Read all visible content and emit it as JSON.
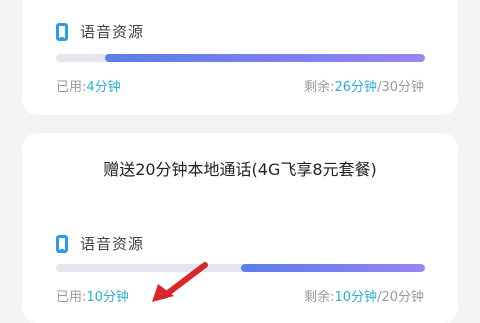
{
  "section1": {
    "resource_label": "语音资源",
    "used_prefix": "已用:",
    "used_value": "4分钟",
    "remaining_prefix": "剩余:",
    "remaining_value": "26分钟",
    "total_suffix": "/30分钟",
    "remaining_fraction": 0.8667
  },
  "section2": {
    "title": "赠送20分钟本地通话(4G飞享8元套餐)",
    "resource_label": "语音资源",
    "used_prefix": "已用:",
    "used_value": "10分钟",
    "remaining_prefix": "剩余:",
    "remaining_value": "10分钟",
    "total_suffix": "/20分钟",
    "remaining_fraction": 0.5
  },
  "colors": {
    "accent_blue": "#2f9be8",
    "highlight_teal": "#2bb0d6",
    "bar_fill": "#7a7ff0",
    "arrow_red": "#d8262b"
  },
  "icons": [
    "phone-icon",
    "arrow-icon"
  ]
}
